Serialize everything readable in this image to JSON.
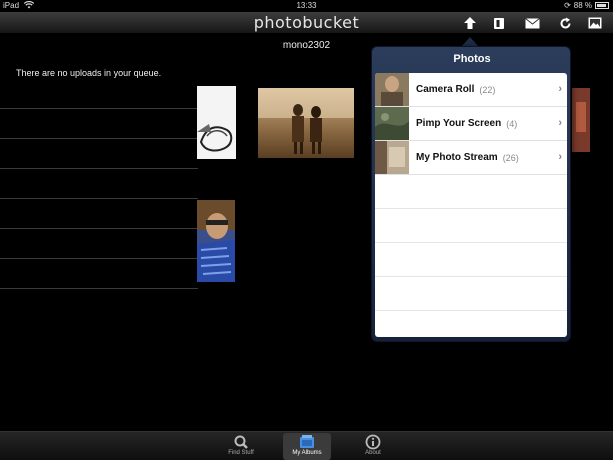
{
  "status_bar": {
    "carrier": "iPad",
    "time": "13:33",
    "battery_text": "88 %",
    "battery_level": 0.88
  },
  "nav": {
    "logo": "photobucket",
    "icons": [
      "upload-icon",
      "bookmark-icon",
      "mail-icon",
      "refresh-icon",
      "photo-icon"
    ]
  },
  "username": "mono2302",
  "queue": {
    "message": "There are no uploads in your queue."
  },
  "popover": {
    "title": "Photos",
    "albums": [
      {
        "name": "Camera Roll",
        "count": "(22)"
      },
      {
        "name": "Pimp Your Screen",
        "count": "(4)"
      },
      {
        "name": "My Photo Stream",
        "count": "(26)"
      }
    ]
  },
  "tabs": [
    {
      "label": "Find Stuff",
      "icon": "search-icon",
      "active": false
    },
    {
      "label": "My Albums",
      "icon": "albums-icon",
      "active": true
    },
    {
      "label": "About",
      "icon": "info-icon",
      "active": false
    }
  ]
}
